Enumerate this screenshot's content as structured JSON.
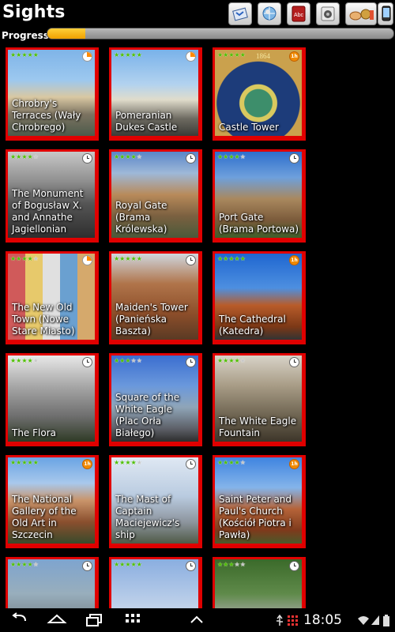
{
  "header": {
    "title": "Sights",
    "progress_label": "Progress",
    "progress_fraction": 0.11
  },
  "toolbar": [
    {
      "name": "map-icon"
    },
    {
      "name": "globe-icon"
    },
    {
      "name": "dictionary-icon",
      "label": "Abc"
    },
    {
      "name": "speaker-icon"
    },
    {
      "name": "food-icon"
    },
    {
      "name": "phone-icon"
    }
  ],
  "sights": [
    {
      "label": "Chrobry's Terraces (Wały Chrobrego)",
      "stars": 5,
      "badge": "pie"
    },
    {
      "label": "Pomeranian Dukes Castle",
      "stars": 5,
      "badge": "pie"
    },
    {
      "label": "Castle Tower",
      "stars": 5,
      "badge": "level",
      "badge_text": "1h",
      "image_text": "1864"
    },
    {
      "label": "The Monument of Bogusław X. and Annathe Jagiellonian",
      "stars": 4,
      "badge": "clock"
    },
    {
      "label": "Royal Gate (Brama Królewska)",
      "stars": 4,
      "badge": "clock"
    },
    {
      "label": "Port Gate (Brama Portowa)",
      "stars": 4,
      "badge": "clock"
    },
    {
      "label": "The New Old Town (Nowe Stare Miasto)",
      "stars": 4,
      "badge": "pie"
    },
    {
      "label": "Maiden's Tower (Panieńska Baszta)",
      "stars": 5,
      "badge": "clock"
    },
    {
      "label": "The Cathedral (Katedra)",
      "stars": 5,
      "badge": "level",
      "badge_text": "1h"
    },
    {
      "label": "The Flora",
      "stars": 4,
      "badge": "clock"
    },
    {
      "label": "Square of the White Eagle (Plac Orła Białego)",
      "stars": 3,
      "badge": "clock"
    },
    {
      "label": "The White Eagle Fountain",
      "stars": 4,
      "badge": "clock"
    },
    {
      "label": "The National Gallery of the Old Art in Szczecin",
      "stars": 5,
      "badge": "level",
      "badge_text": "1h"
    },
    {
      "label": "The Mast of Captain Maciejewicz's ship",
      "stars": 4,
      "badge": "clock"
    },
    {
      "label": "Saint Peter and Paul's Church (Kościół Piotra i Pawła)",
      "stars": 4,
      "badge": "level",
      "badge_text": "1h"
    },
    {
      "label": "",
      "stars": 4,
      "badge": "clock"
    },
    {
      "label": "",
      "stars": 5,
      "badge": "clock"
    },
    {
      "label": "",
      "stars": 3,
      "badge": "clock"
    }
  ],
  "statusbar": {
    "time": "18:05",
    "nav_buttons": [
      "back-icon",
      "home-icon",
      "recent-apps-icon",
      "menu-icon",
      "up-icon"
    ]
  },
  "colors": {
    "tile_border": "#e00000",
    "star_on": "#4ec000",
    "progress_fill": "#f0a000"
  }
}
